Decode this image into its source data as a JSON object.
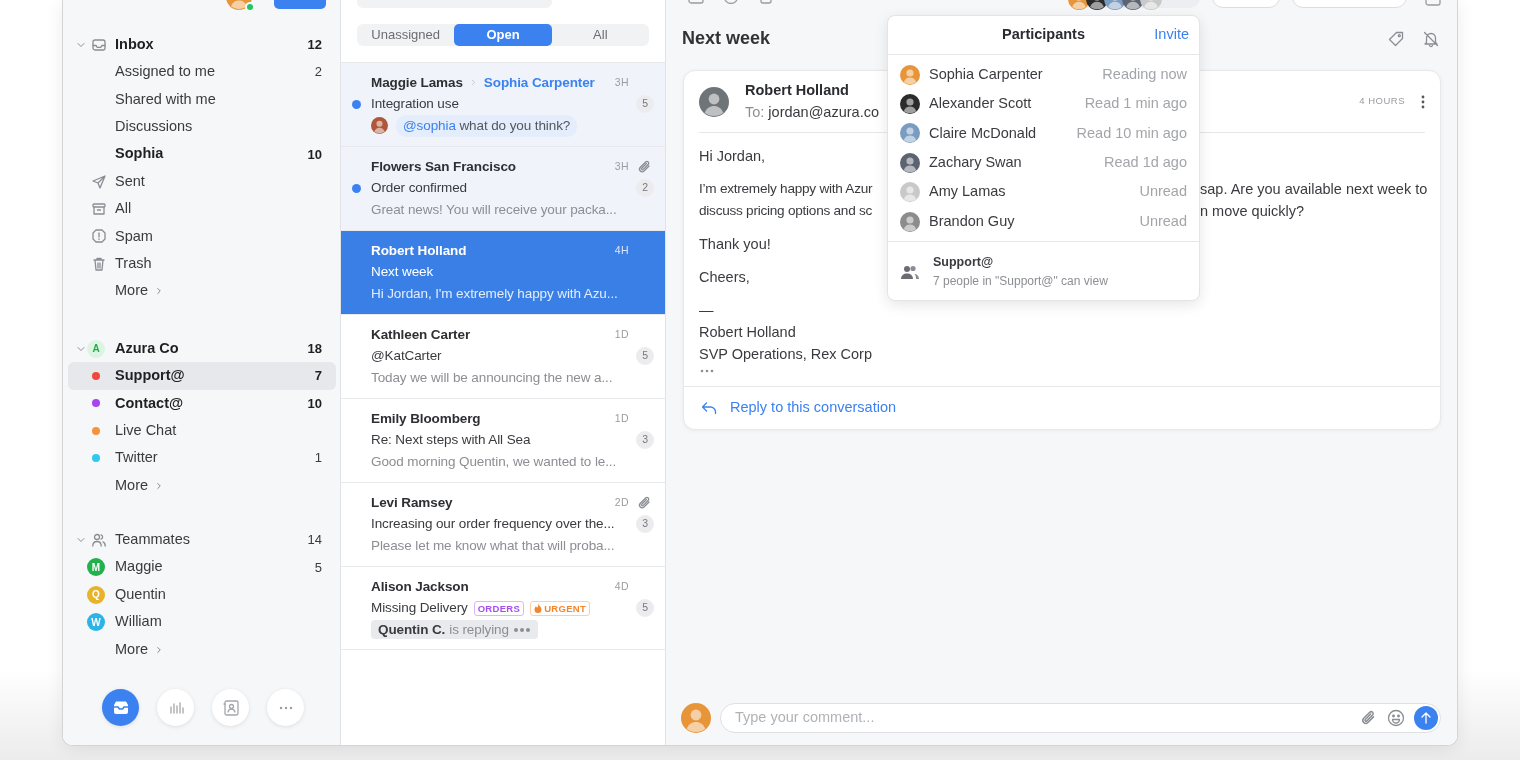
{
  "account": {
    "online": true
  },
  "sidebar": {
    "sections": [
      {
        "label": "Inbox",
        "count": "12",
        "expanded": true,
        "unread": true,
        "kind": "inbox",
        "items": [
          {
            "label": "Assigned to me",
            "count": "2",
            "unread": false,
            "selected": false,
            "kind": "plain"
          },
          {
            "label": "Shared with me",
            "unread": false,
            "selected": false,
            "kind": "plain"
          },
          {
            "label": "Discussions",
            "unread": false,
            "selected": false,
            "kind": "plain"
          },
          {
            "label": "Sophia",
            "count": "10",
            "unread": true,
            "selected": false,
            "kind": "plain"
          },
          {
            "label": "Sent",
            "unread": false,
            "selected": false,
            "kind": "folder"
          },
          {
            "label": "All",
            "unread": false,
            "selected": false,
            "kind": "folder"
          },
          {
            "label": "Spam",
            "unread": false,
            "selected": false,
            "kind": "folder"
          },
          {
            "label": "Trash",
            "unread": false,
            "selected": false,
            "kind": "folder"
          },
          {
            "label": "More",
            "unread": false,
            "selected": false,
            "kind": "more"
          }
        ]
      },
      {
        "label": "Azura Co",
        "count": "18",
        "expanded": true,
        "unread": true,
        "kind": "team",
        "initial": "A",
        "items": [
          {
            "label": "Support@",
            "count": "7",
            "unread": true,
            "selected": true,
            "kind": "channel",
            "color": "#f0483e"
          },
          {
            "label": "Contact@",
            "count": "10",
            "unread": true,
            "selected": false,
            "kind": "channel",
            "color": "#a445f0"
          },
          {
            "label": "Live Chat",
            "unread": false,
            "selected": false,
            "kind": "channel",
            "color": "#f7923a"
          },
          {
            "label": "Twitter",
            "count": "1",
            "unread": false,
            "selected": false,
            "kind": "channel",
            "color": "#2ec8f0"
          },
          {
            "label": "More",
            "unread": false,
            "selected": false,
            "kind": "more"
          }
        ]
      },
      {
        "label": "Teammates",
        "count": "14",
        "expanded": true,
        "unread": false,
        "kind": "people",
        "items": [
          {
            "label": "Maggie",
            "count": "5",
            "unread": false,
            "selected": false,
            "kind": "person",
            "initial": "M",
            "color": "#22b14c"
          },
          {
            "label": "Quentin",
            "unread": false,
            "selected": false,
            "kind": "person",
            "initial": "Q",
            "color": "#e6b32a"
          },
          {
            "label": "William",
            "unread": false,
            "selected": false,
            "kind": "person",
            "initial": "W",
            "color": "#2bb4e6"
          },
          {
            "label": "More",
            "unread": false,
            "selected": false,
            "kind": "more"
          }
        ]
      }
    ],
    "nav_buttons": [
      {
        "selected": true
      },
      {
        "selected": false
      },
      {
        "selected": false
      },
      {
        "selected": false
      }
    ]
  },
  "filter_tabs": [
    {
      "label": "Unassigned",
      "selected": false
    },
    {
      "label": "Open",
      "selected": true
    },
    {
      "label": "All",
      "selected": false
    }
  ],
  "conversations": [
    {
      "from": "Maggie Lamas",
      "to": "Sophia Carpenter",
      "time": "3H",
      "subject": "Integration use",
      "count": "5",
      "unread": true,
      "selected": false,
      "attachment": false,
      "comment": {
        "mention": "@sophia",
        "text": "what do you think?"
      }
    },
    {
      "from": "Flowers San Francisco",
      "time": "3H",
      "subject": "Order confirmed",
      "count": "2",
      "preview": "Great news! You will receive your packa...",
      "unread": true,
      "selected": false,
      "attachment": true
    },
    {
      "from": "Robert Holland",
      "time": "4H",
      "subject": "Next week",
      "preview": "Hi Jordan, I'm extremely happy with Azu...",
      "unread": false,
      "selected": true,
      "attachment": false
    },
    {
      "from": "Kathleen Carter",
      "time": "1D",
      "subject": "@KatCarter",
      "count": "5",
      "preview": "Today we will be announcing the new a...",
      "unread": false,
      "selected": false,
      "attachment": false
    },
    {
      "from": "Emily Bloomberg",
      "time": "1D",
      "subject": "Re: Next steps with All Sea",
      "count": "3",
      "preview": "Good morning Quentin, we wanted to le...",
      "unread": false,
      "selected": false,
      "attachment": false
    },
    {
      "from": "Levi Ramsey",
      "time": "2D",
      "subject": "Increasing our order frequency over the...",
      "count": "3",
      "preview": "Please let me know what that will proba...",
      "unread": false,
      "selected": false,
      "attachment": true
    },
    {
      "from": "Alison Jackson",
      "time": "4D",
      "subject": "Missing Delivery",
      "count": "5",
      "unread": false,
      "selected": false,
      "attachment": false,
      "tags": [
        {
          "label": "ORDERS",
          "kind": "plain",
          "color": "#a44df0"
        },
        {
          "label": "URGENT",
          "kind": "hot",
          "color": "#f2862e"
        }
      ],
      "typing": {
        "name": "Quentin C.",
        "text": "is replying"
      }
    }
  ],
  "conversation": {
    "title": "Next week",
    "message": {
      "from": "Robert Holland",
      "to_label": "To:",
      "to": "jordan@azura.co",
      "time": "4 HOURS",
      "body": [
        {
          "kind": "text",
          "lines": [
            "Hi Jordan,"
          ]
        },
        {
          "kind": "covered",
          "lines": [
            {
              "left": "I’m extremely happy with Azur",
              "right": "sap. Are you available next week to"
            },
            {
              "left": "discuss pricing options and sc",
              "right": "n move quickly?"
            }
          ]
        },
        {
          "kind": "text",
          "lines": [
            "Thank you!"
          ]
        },
        {
          "kind": "text",
          "lines": [
            "Cheers,"
          ]
        },
        {
          "kind": "text",
          "lines": [
            "—",
            "Robert Holland",
            "SVP Operations, Rex Corp"
          ]
        }
      ],
      "quote_collapsed": true,
      "reply": "Reply to this conversation"
    }
  },
  "participants_popover": {
    "title": "Participants",
    "action": "Invite",
    "people": [
      {
        "name": "Sophia Carpenter",
        "status": "Reading now"
      },
      {
        "name": "Alexander Scott",
        "status": "Read 1 min ago"
      },
      {
        "name": "Claire McDonald",
        "status": "Read 10 min ago"
      },
      {
        "name": "Zachary Swan",
        "status": "Read 1d ago"
      },
      {
        "name": "Amy Lamas",
        "status": "Unread"
      },
      {
        "name": "Brandon Guy",
        "status": "Unread"
      }
    ],
    "group": {
      "name": "Support@",
      "text": "7 people in \"Support@\" can view"
    }
  },
  "composer": {
    "placeholder": "Type your comment..."
  }
}
